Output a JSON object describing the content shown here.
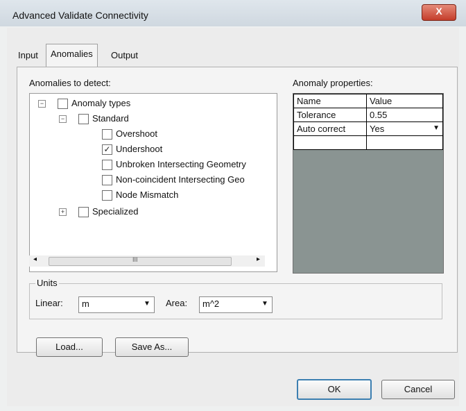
{
  "window": {
    "title": "Advanced Validate Connectivity",
    "close_glyph": "X"
  },
  "tabs": [
    {
      "label": "Input"
    },
    {
      "label": "Anomalies"
    },
    {
      "label": "Output"
    }
  ],
  "anomalies": {
    "section_label": "Anomalies to detect:",
    "tree": {
      "root": {
        "label": "Anomaly types",
        "expander": "−",
        "checked": false
      },
      "standard": {
        "label": "Standard",
        "expander": "−",
        "checked": false
      },
      "items": [
        {
          "label": "Overshoot",
          "checked": false
        },
        {
          "label": "Undershoot",
          "checked": true
        },
        {
          "label": "Unbroken Intersecting Geometry",
          "checked": false
        },
        {
          "label": "Non-coincident Intersecting Geo",
          "checked": false
        },
        {
          "label": "Node Mismatch",
          "checked": false
        }
      ],
      "specialized": {
        "label": "Specialized",
        "expander": "+",
        "checked": false
      }
    },
    "scrollbar": {
      "left_arrow": "◂",
      "right_arrow": "▸",
      "grip": "III"
    }
  },
  "properties": {
    "section_label": "Anomaly properties:",
    "headers": [
      "Name",
      "Value"
    ],
    "rows": [
      {
        "name": "Tolerance",
        "value": "0.55"
      },
      {
        "name": "Auto correct",
        "value": "Yes"
      }
    ]
  },
  "units": {
    "group_label": "Units",
    "linear_label": "Linear:",
    "linear_value": "m",
    "area_label": "Area:",
    "area_value": "m^2"
  },
  "buttons": {
    "load": "Load...",
    "save_as": "Save As...",
    "ok": "OK",
    "cancel": "Cancel"
  }
}
